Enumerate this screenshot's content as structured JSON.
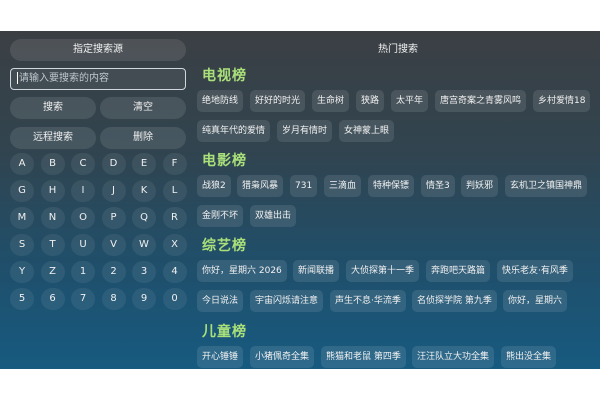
{
  "left": {
    "source_button": "指定搜索源",
    "search_placeholder": "请输入要搜索的内容",
    "search_button": "搜索",
    "clear_button": "清空",
    "remote_search_button": "远程搜索",
    "delete_button": "删除",
    "keys": [
      "A",
      "B",
      "C",
      "D",
      "E",
      "F",
      "G",
      "H",
      "I",
      "J",
      "K",
      "L",
      "M",
      "N",
      "O",
      "P",
      "Q",
      "R",
      "S",
      "T",
      "U",
      "V",
      "W",
      "X",
      "Y",
      "Z",
      "1",
      "2",
      "3",
      "4",
      "5",
      "6",
      "7",
      "8",
      "9",
      "0"
    ]
  },
  "right": {
    "title": "热门搜索",
    "categories": [
      {
        "name": "电视榜",
        "rows": [
          [
            "绝地防线",
            "好好的时光",
            "生命树",
            "狭路",
            "太平年",
            "唐宫奇案之青雾风鸣",
            "乡村爱情18"
          ],
          [
            "纯真年代的爱情",
            "岁月有情时",
            "女神蒙上眼"
          ]
        ]
      },
      {
        "name": "电影榜",
        "rows": [
          [
            "战狼2",
            "猎枭风暴",
            "731",
            "三滴血",
            "特种保镖",
            "情圣3",
            "判妖邪",
            "玄机卫之镇国神鼎"
          ],
          [
            "金刚不坏",
            "双雄出击"
          ]
        ]
      },
      {
        "name": "综艺榜",
        "rows": [
          [
            "你好，星期六 2026",
            "新闻联播",
            "大侦探第十一季",
            "奔跑吧天路篇",
            "快乐老友·有风季"
          ],
          [
            "今日说法",
            "宇宙闪烁请注意",
            "声生不息·华流季",
            "名侦探学院 第九季",
            "你好，星期六"
          ]
        ]
      },
      {
        "name": "儿童榜",
        "rows": [
          [
            "开心锤锤",
            "小猪佩奇全集",
            "熊猫和老鼠 第四季",
            "汪汪队立大功全集",
            "熊出没全集"
          ]
        ]
      }
    ]
  }
}
